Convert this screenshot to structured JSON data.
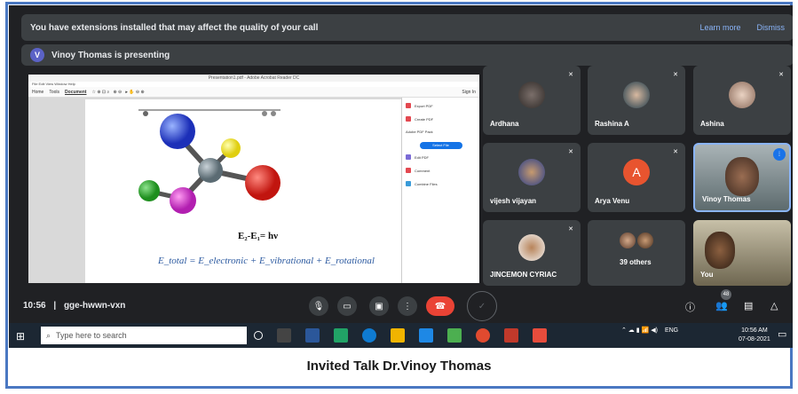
{
  "banner": {
    "message": "You have extensions installed that may affect the quality of your call",
    "learn_more": "Learn more",
    "dismiss": "Dismiss"
  },
  "presenting": {
    "avatar_letter": "V",
    "text": "Vinoy Thomas is presenting"
  },
  "shared_screen": {
    "window_title": "Presentation1.pdf - Adobe Acrobat Reader DC",
    "menu": "File  Edit  View  Window  Help",
    "toolbar": [
      "Home",
      "Tools",
      "Document"
    ],
    "sign_in": "Sign In",
    "side_panel": [
      "Export PDF",
      "Create PDF",
      "Adobe PDF Pack",
      "Select File",
      "Edit PDF",
      "Comment",
      "Combine Files"
    ],
    "equation1": "E₂-E₁= hν",
    "equation2": "E_total = E_electronic + E_vibrational + E_rotational"
  },
  "participants": [
    {
      "name": "Ardhana",
      "type": "photo"
    },
    {
      "name": "Rashina A",
      "type": "photo"
    },
    {
      "name": "Ashina",
      "type": "photo"
    },
    {
      "name": "vijesh vijayan",
      "type": "photo"
    },
    {
      "name": "Arya Venu",
      "type": "initial",
      "initial": "A"
    },
    {
      "name": "Vinoy Thomas",
      "type": "camera"
    },
    {
      "name": "JINCEMON CYRIAC",
      "type": "photo"
    },
    {
      "name": "39 others",
      "type": "group"
    },
    {
      "name": "You",
      "type": "camera"
    }
  ],
  "bottombar": {
    "time": "10:56",
    "separator": "|",
    "meeting_code": "gge-hwwn-vxn",
    "participant_count": "48"
  },
  "taskbar": {
    "search_placeholder": "Type here to search",
    "lang": "ENG",
    "time": "10:56 AM",
    "date": "07-08-2021"
  },
  "caption": "Invited Talk Dr.Vinoy Thomas",
  "colors": {
    "meet_bg": "#202124",
    "tile_bg": "#3c4043",
    "end_call": "#ea4335",
    "link": "#8ab4f8",
    "frame": "#4a78c2"
  }
}
